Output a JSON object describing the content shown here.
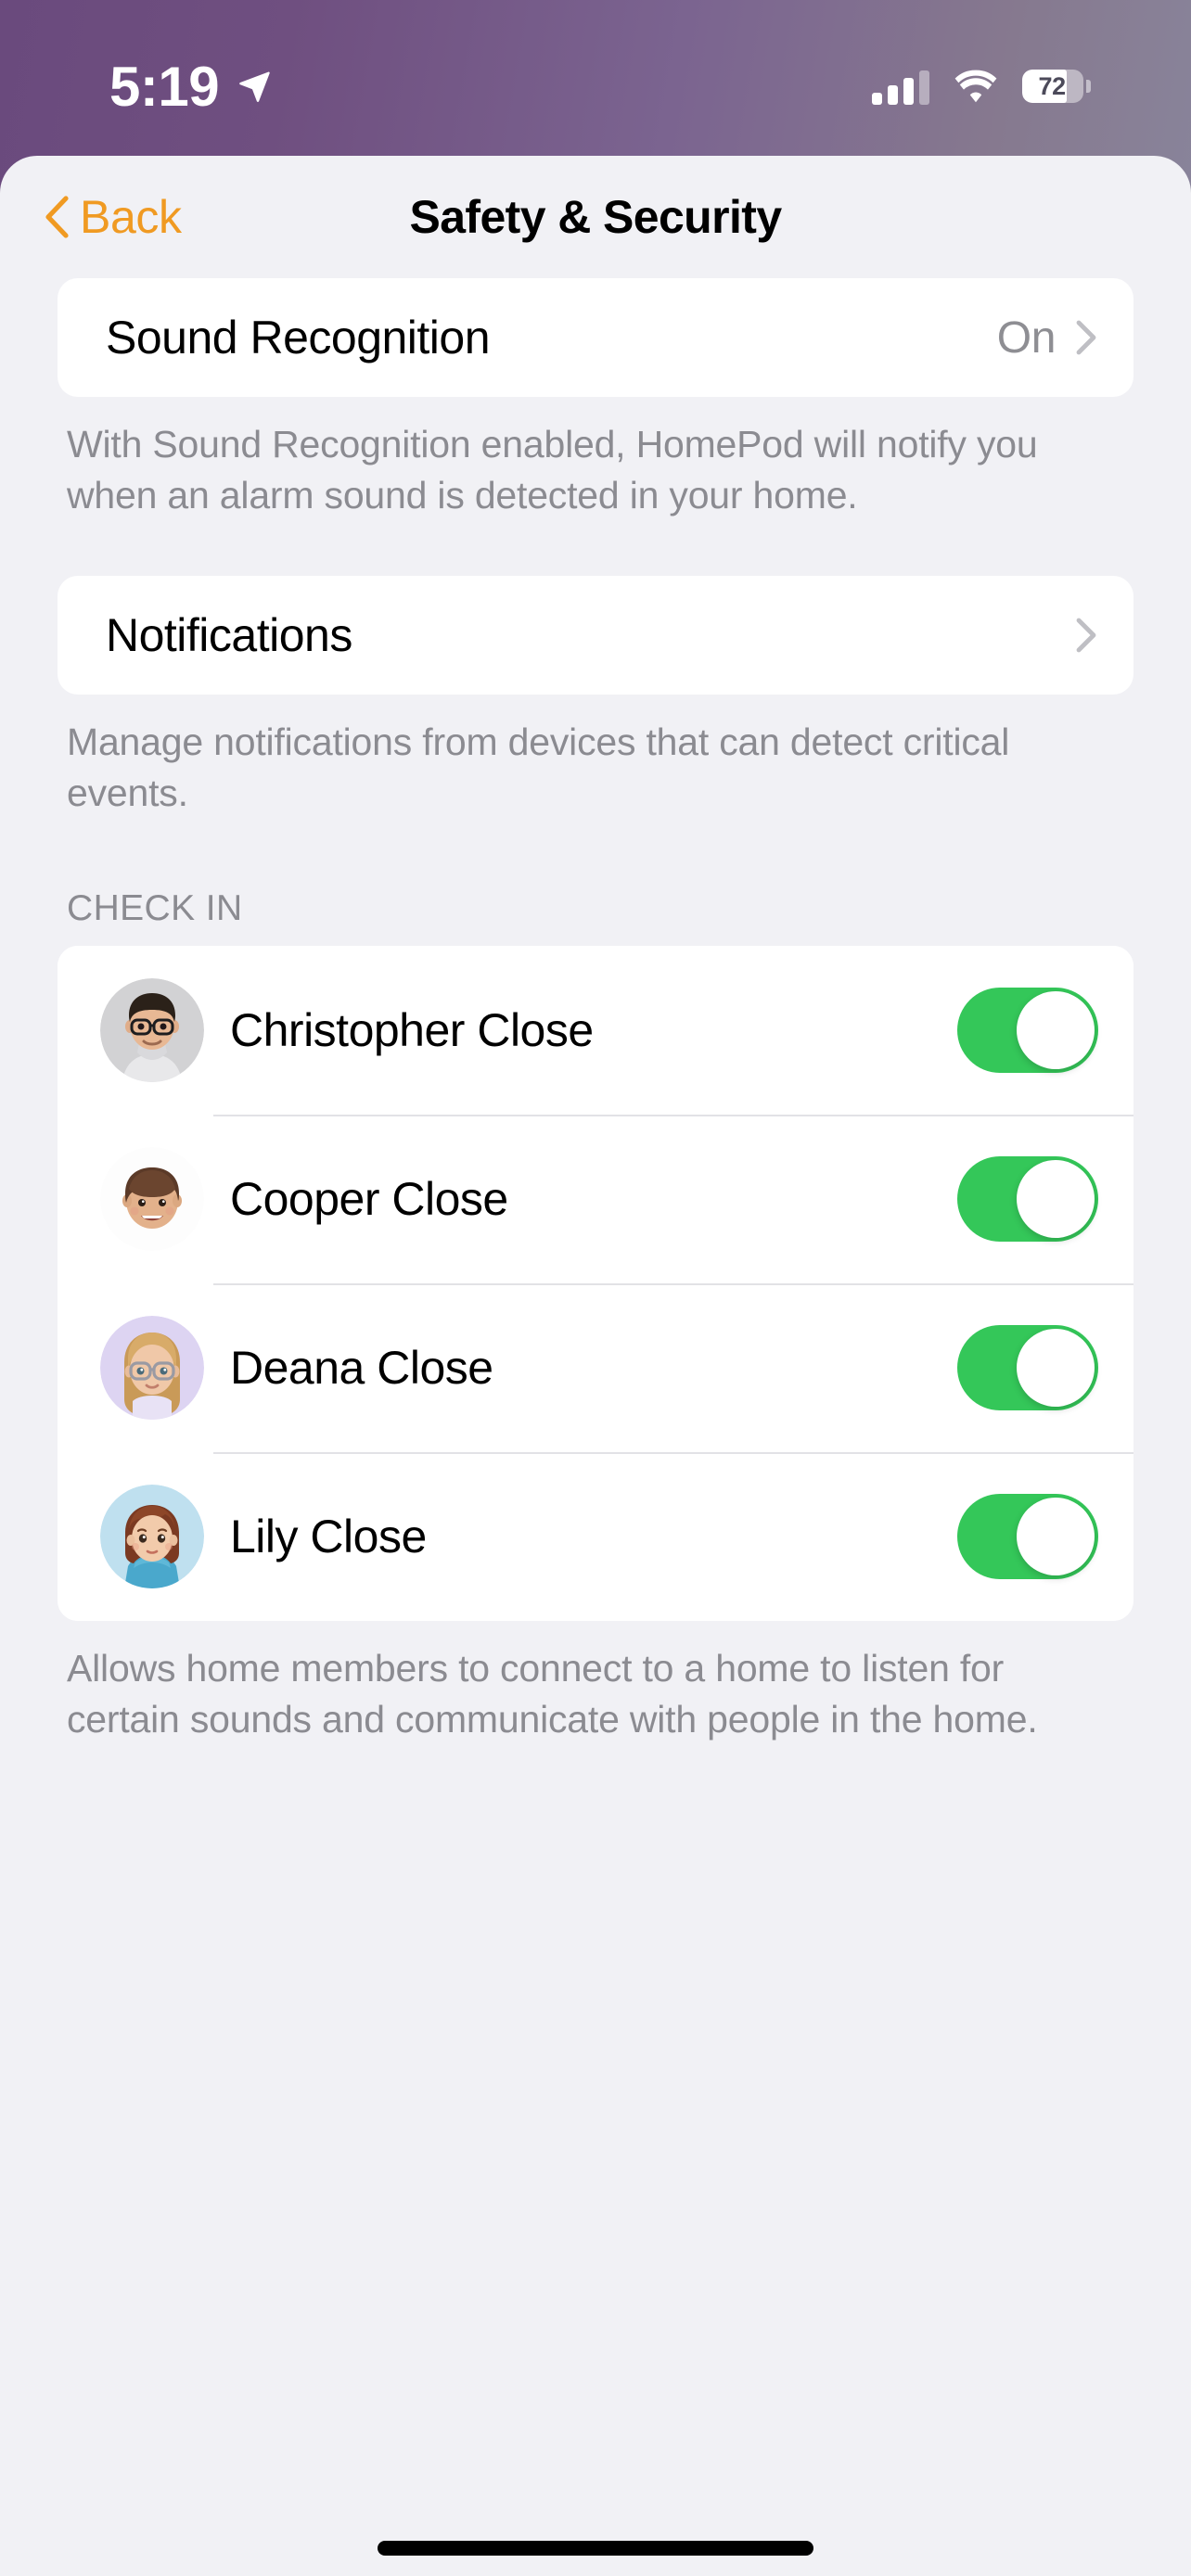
{
  "status_bar": {
    "time": "5:19",
    "location_icon": "location-arrow-icon",
    "cellular_icon": "cellular-signal-icon",
    "cellular_bars_filled": 3,
    "cellular_bars_total": 4,
    "wifi_icon": "wifi-icon",
    "battery_icon": "battery-icon",
    "battery_percent": "72",
    "battery_level": 72
  },
  "nav": {
    "back_label": "Back",
    "back_icon": "chevron-left-icon",
    "title": "Safety & Security"
  },
  "sections": {
    "sound_recognition": {
      "label": "Sound Recognition",
      "value": "On",
      "disclosure_icon": "chevron-right-icon",
      "footer": "With Sound Recognition enabled, HomePod will notify you when an alarm sound is detected in your home."
    },
    "notifications": {
      "label": "Notifications",
      "disclosure_icon": "chevron-right-icon",
      "footer": "Manage notifications from devices that can detect critical events."
    },
    "check_in": {
      "header": "CHECK IN",
      "footer": "Allows home members to connect to a home to listen for certain sounds and communicate with people in the home.",
      "people": [
        {
          "name": "Christopher Close",
          "avatar": "memoji-avatar",
          "enabled": true,
          "toggle_state": "on"
        },
        {
          "name": "Cooper Close",
          "avatar": "memoji-avatar",
          "enabled": true,
          "toggle_state": "on"
        },
        {
          "name": "Deana Close",
          "avatar": "memoji-avatar",
          "enabled": true,
          "toggle_state": "on"
        },
        {
          "name": "Lily Close",
          "avatar": "memoji-avatar",
          "enabled": true,
          "toggle_state": "on"
        }
      ]
    }
  },
  "colors": {
    "accent": "#f09a22",
    "toggle_on": "#34c759",
    "background": "#f1f1f5",
    "card": "#ffffff",
    "secondary_text": "#8b8b91"
  },
  "home_indicator": "home-indicator"
}
